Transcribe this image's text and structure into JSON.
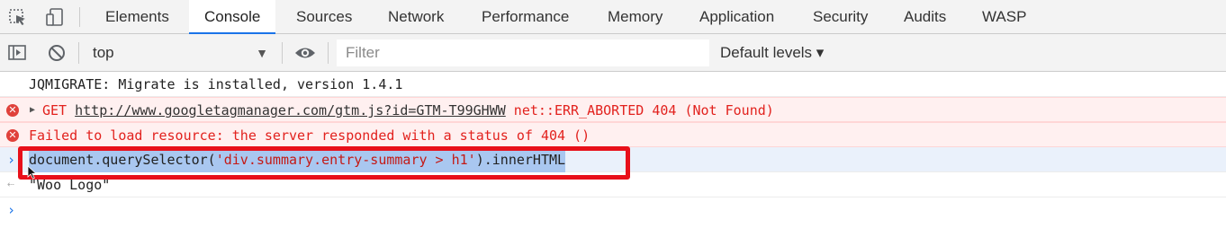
{
  "tabs": [
    {
      "label": "Elements"
    },
    {
      "label": "Console"
    },
    {
      "label": "Sources"
    },
    {
      "label": "Network"
    },
    {
      "label": "Performance"
    },
    {
      "label": "Memory"
    },
    {
      "label": "Application"
    },
    {
      "label": "Security"
    },
    {
      "label": "Audits"
    },
    {
      "label": "WASP"
    }
  ],
  "active_tab": "Console",
  "toolbar": {
    "context": "top",
    "filter_placeholder": "Filter",
    "filter_value": "",
    "levels_label": "Default levels ▾"
  },
  "console": {
    "log1": "JQMIGRATE: Migrate is installed, version 1.4.1",
    "err1_method": "GET",
    "err1_url": "http://www.googletagmanager.com/gtm.js?id=GTM-T99GHWW",
    "err1_status": "net::ERR_ABORTED 404 (Not Found)",
    "err2": "Failed to load resource: the server responded with a status of 404 ()",
    "input_prefix": "document.querySelector(",
    "input_string": "'div.summary.entry-summary > h1'",
    "input_suffix": ").innerHTML",
    "result": "\"Woo Logo\""
  },
  "colors": {
    "error_text": "#e2221e",
    "error_bg": "#fff0f0",
    "active_tab_underline": "#1a73e8",
    "highlight_box": "#e8101a",
    "selection": "#a9c7f0"
  }
}
